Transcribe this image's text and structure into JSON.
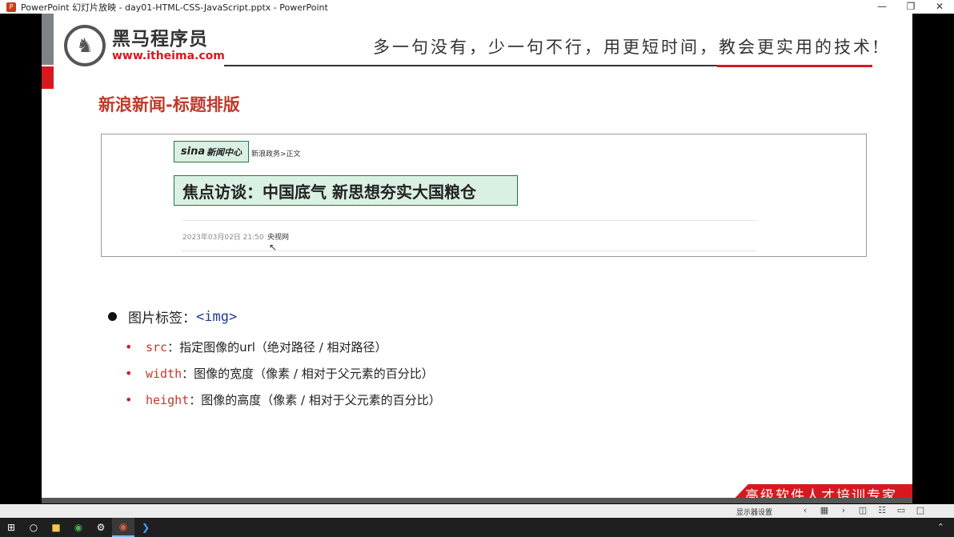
{
  "window": {
    "title": "PowerPoint 幻灯片放映  -  day01-HTML-CSS-JavaScript.pptx - PowerPoint",
    "app_icon": "P"
  },
  "slide": {
    "logo_cn": "黑马程序员",
    "logo_url": "www.itheima.com",
    "slogan": "多一句没有，少一句不行，用更短时间，教会更实用的技术!",
    "title": "新浪新闻-标题排版",
    "sina": {
      "logo_text": "新闻中心",
      "logo_brand": "sina",
      "breadcrumb": "新浪政务>正文",
      "headline": "焦点访谈：中国底气 新思想夯实大国粮仓",
      "date": "2023年03月02日 21:50",
      "source": "央视网"
    },
    "bullet": {
      "label": "图片标签：",
      "tag": "<img>"
    },
    "sub_items": [
      {
        "code": "src",
        "text": "：指定图像的url（绝对路径 / 相对路径）"
      },
      {
        "code": "width",
        "text": "：图像的宽度（像素 / 相对于父元素的百分比）"
      },
      {
        "code": "height",
        "text": "：图像的高度（像素 / 相对于父元素的百分比）"
      }
    ],
    "footer_banner": "高级软件人才培训专家"
  },
  "showbar": {
    "label": "显示器设置"
  }
}
